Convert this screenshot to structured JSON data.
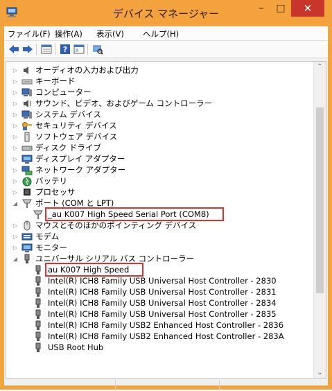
{
  "window": {
    "title": "デバイス マネージャー"
  },
  "menu": [
    "ファイル(F)",
    "操作(A)",
    "表示(V)",
    "ヘルプ(H)"
  ],
  "tree": {
    "categories": [
      {
        "label": "オーディオの入力および出力",
        "icon": "audio-icon"
      },
      {
        "label": "キーボード",
        "icon": "keyboard-icon"
      },
      {
        "label": "コンピューター",
        "icon": "computer-icon"
      },
      {
        "label": "サウンド、ビデオ、およびゲーム コントローラー",
        "icon": "speaker-icon"
      },
      {
        "label": "システム デバイス",
        "icon": "system-icon"
      },
      {
        "label": "セキュリティ デバイス",
        "icon": "key-icon"
      },
      {
        "label": "ソフトウェア デバイス",
        "icon": "software-icon"
      },
      {
        "label": "ディスク ドライブ",
        "icon": "disk-icon"
      },
      {
        "label": "ディスプレイ アダプター",
        "icon": "display-icon"
      },
      {
        "label": "ネットワーク アダプター",
        "icon": "network-icon"
      },
      {
        "label": "バッテリ",
        "icon": "battery-icon"
      },
      {
        "label": "プロセッサ",
        "icon": "processor-icon"
      },
      {
        "label": "ポート (COM と LPT)",
        "icon": "port-icon"
      },
      {
        "label": "_au K007 High Speed Serial Port (COM8)",
        "icon": "port-icon"
      },
      {
        "label": "マウスとそのほかのポインティング デバイス",
        "icon": "mouse-icon"
      },
      {
        "label": "モデム",
        "icon": "modem-icon"
      },
      {
        "label": "モニター",
        "icon": "monitor-icon"
      },
      {
        "label": "ユニバーサル シリアル バス コントローラー",
        "icon": "usb-icon"
      },
      {
        "label": "au K007 High Speed",
        "icon": "usb-icon"
      },
      {
        "label": "Intel(R) ICH8 Family USB Universal Host Controller - 2830",
        "icon": "usb-icon"
      },
      {
        "label": "Intel(R) ICH8 Family USB Universal Host Controller - 2831",
        "icon": "usb-icon"
      },
      {
        "label": "Intel(R) ICH8 Family USB Universal Host Controller - 2834",
        "icon": "usb-icon"
      },
      {
        "label": "Intel(R) ICH8 Family USB Universal Host Controller - 2835",
        "icon": "usb-icon"
      },
      {
        "label": "Intel(R) ICH8 Family USB2 Enhanced Host Controller - 2836",
        "icon": "usb-icon"
      },
      {
        "label": "Intel(R) ICH8 Family USB2 Enhanced Host Controller - 283A",
        "icon": "usb-icon"
      },
      {
        "label": "USB Root Hub",
        "icon": "usb-icon"
      }
    ]
  },
  "colors": {
    "titlebar": "#f4a23d",
    "close": "#c7352b",
    "highlight": "#e0322b"
  }
}
